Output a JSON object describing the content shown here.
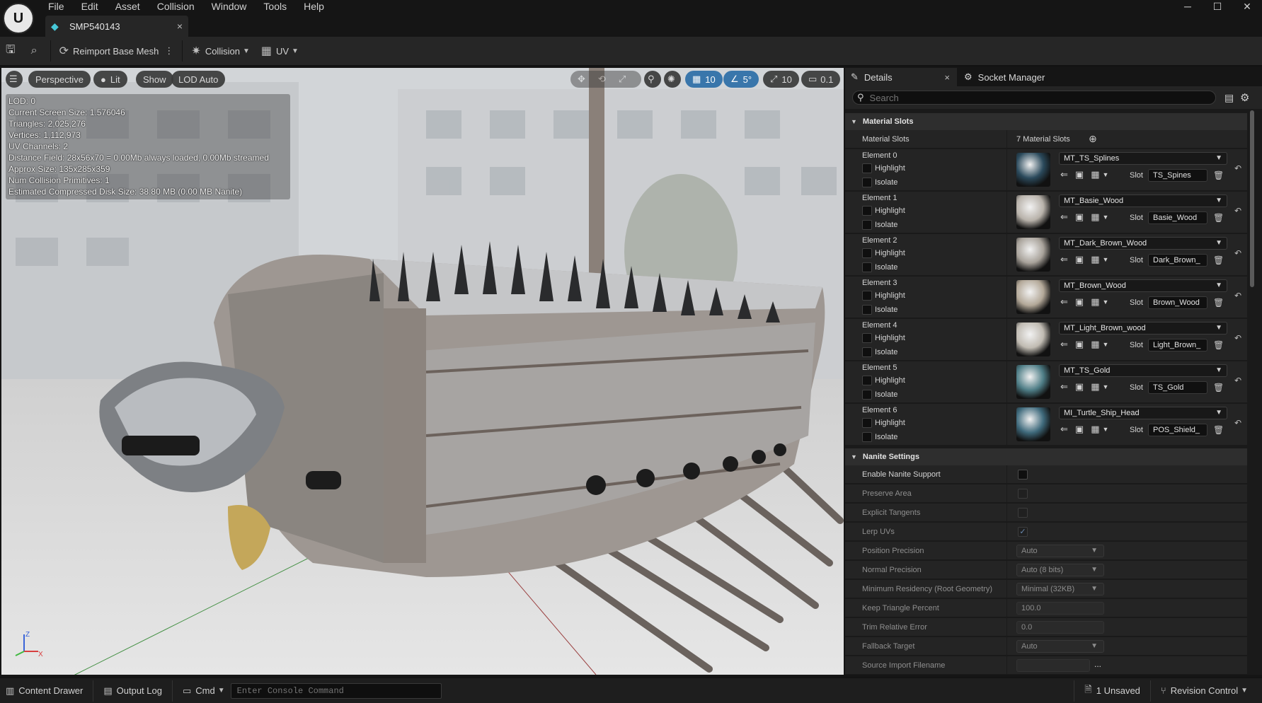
{
  "menu": [
    "File",
    "Edit",
    "Asset",
    "Collision",
    "Window",
    "Tools",
    "Help"
  ],
  "window_controls": {
    "minimize": "─",
    "maximize": "☐",
    "close": "✕"
  },
  "asset_tab": {
    "label": "SMP540143",
    "close": "×"
  },
  "toolbar": {
    "reimport_label": "Reimport Base Mesh",
    "collision_label": "Collision",
    "uv_label": "UV"
  },
  "viewport": {
    "perspective": "Perspective",
    "lit": "Lit",
    "show": "Show",
    "lod": "LOD Auto",
    "grid_snap": "10",
    "rotation_snap": "5°",
    "scale_snap": "10",
    "camera_speed": "0.1",
    "stats": [
      "LOD:  0",
      "Current Screen Size:  1.576046",
      "Triangles:  2,025,276",
      "Vertices:  1,112,973",
      "UV Channels:  2",
      "Distance Field:  28x56x70 = 0.00Mb always loaded, 0.00Mb streamed",
      "Approx Size:  135x285x359",
      "Num Collision Primitives:  1",
      "Estimated Compressed Disk Size: 38.80 MB (0.00 MB Nanite)"
    ],
    "axis": {
      "z": "Z",
      "x": "X"
    }
  },
  "details": {
    "tab_details": "Details",
    "tab_close": "×",
    "tab_socket": "Socket Manager",
    "search_placeholder": "Search",
    "material_slots_header": "Material Slots",
    "material_slots_label": "Material Slots",
    "material_slots_count": "7 Material Slots",
    "highlight_label": "Highlight",
    "isolate_label": "Isolate",
    "slot_label": "Slot",
    "elements": [
      {
        "name": "Element 0",
        "material": "MT_TS_Splines",
        "slot": "TS_Spines",
        "thumb": "#2b4a5c"
      },
      {
        "name": "Element 1",
        "material": "MT_Basie_Wood",
        "slot": "Basie_Wood",
        "thumb": "#b8b2aa"
      },
      {
        "name": "Element 2",
        "material": "MT_Dark_Brown_Wood",
        "slot": "Dark_Brown_",
        "thumb": "#a8a29a"
      },
      {
        "name": "Element 3",
        "material": "MT_Brown_Wood",
        "slot": "Brown_Wood",
        "thumb": "#b3a898"
      },
      {
        "name": "Element 4",
        "material": "MT_Light_Brown_wood",
        "slot": "Light_Brown_",
        "thumb": "#c0bbb2"
      },
      {
        "name": "Element 5",
        "material": "MT_TS_Gold",
        "slot": "TS_Gold",
        "thumb": "#4e7d86"
      },
      {
        "name": "Element 6",
        "material": "MI_Turtle_Ship_Head",
        "slot": "POS_Shield_",
        "thumb": "#3f6a7c"
      }
    ],
    "nanite_header": "Nanite Settings",
    "nanite": {
      "enable": "Enable Nanite Support",
      "preserve_area": "Preserve Area",
      "explicit_tangents": "Explicit Tangents",
      "lerp_uvs": "Lerp UVs",
      "position_precision": "Position Precision",
      "position_precision_value": "Auto",
      "normal_precision": "Normal Precision",
      "normal_precision_value": "Auto (8 bits)",
      "min_residency": "Minimum Residency (Root Geometry)",
      "min_residency_value": "Minimal (32KB)",
      "keep_triangle": "Keep Triangle Percent",
      "keep_triangle_value": "100.0",
      "trim_error": "Trim Relative Error",
      "trim_error_value": "0.0",
      "fallback_target": "Fallback Target",
      "fallback_target_value": "Auto",
      "source_import": "Source Import Filename",
      "source_import_more": "..."
    }
  },
  "statusbar": {
    "content_drawer": "Content Drawer",
    "output_log": "Output Log",
    "cmd": "Cmd",
    "console_placeholder": "Enter Console Command",
    "unsaved": "1 Unsaved",
    "revision": "Revision Control"
  },
  "colors": {
    "accent_blue": "#2d6fa8",
    "teal_icon": "#47c8d8"
  }
}
